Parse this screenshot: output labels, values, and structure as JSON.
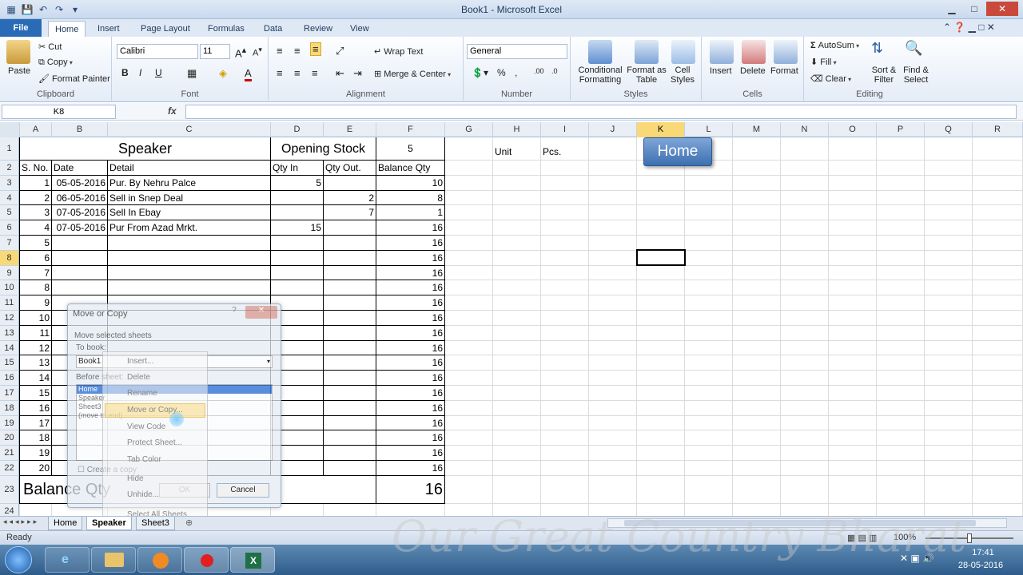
{
  "window": {
    "title": "Book1  -  Microsoft Excel"
  },
  "ribbon_tabs": [
    "File",
    "Home",
    "Insert",
    "Page Layout",
    "Formulas",
    "Data",
    "Review",
    "View"
  ],
  "clipboard": {
    "paste": "Paste",
    "cut": "Cut",
    "copy": "Copy",
    "format_painter": "Format Painter",
    "label": "Clipboard"
  },
  "font": {
    "name": "Calibri",
    "size": "11",
    "label": "Font"
  },
  "alignment": {
    "wrap": "Wrap Text",
    "merge": "Merge & Center",
    "label": "Alignment"
  },
  "number": {
    "format": "General",
    "label": "Number"
  },
  "styles": {
    "conditional": "Conditional Formatting",
    "format_table": "Format as Table",
    "cell_styles": "Cell Styles",
    "label": "Styles"
  },
  "cells": {
    "insert": "Insert",
    "delete": "Delete",
    "format": "Format",
    "label": "Cells"
  },
  "editing": {
    "autosum": "AutoSum",
    "fill": "Fill",
    "clear": "Clear",
    "sort": "Sort & Filter",
    "find": "Find & Select",
    "label": "Editing"
  },
  "formula_bar": {
    "name_box": "K8",
    "fx": "fx"
  },
  "columns": [
    "A",
    "B",
    "C",
    "D",
    "E",
    "F",
    "G",
    "H",
    "I",
    "J",
    "K",
    "L",
    "M",
    "N",
    "O",
    "P",
    "Q",
    "R"
  ],
  "rows": [
    "1",
    "2",
    "3",
    "4",
    "5",
    "6",
    "7",
    "8",
    "9",
    "10",
    "11",
    "12",
    "13",
    "14",
    "15",
    "16",
    "17",
    "18",
    "19",
    "20",
    "21",
    "22",
    "23",
    "24"
  ],
  "sheet": {
    "title": "Speaker",
    "opening_stock_label": "Opening Stock",
    "opening_stock": "5",
    "unit_label": "Unit",
    "unit_value": "Pcs.",
    "home_button": "Home",
    "headers": [
      "S. No.",
      "Date",
      "Detail",
      "Qty In",
      "Qty Out.",
      "Balance Qty"
    ],
    "data_rows": [
      [
        "1",
        "05-05-2016",
        "Pur. By Nehru Palce",
        "5",
        "",
        "10"
      ],
      [
        "2",
        "06-05-2016",
        "Sell in Snep Deal",
        "",
        "2",
        "8"
      ],
      [
        "3",
        "07-05-2016",
        "Sell In Ebay",
        "",
        "7",
        "1"
      ],
      [
        "4",
        "07-05-2016",
        "Pur From Azad Mrkt.",
        "15",
        "",
        "16"
      ],
      [
        "5",
        "",
        "",
        "",
        "",
        "16"
      ],
      [
        "6",
        "",
        "",
        "",
        "",
        "16"
      ],
      [
        "7",
        "",
        "",
        "",
        "",
        "16"
      ],
      [
        "8",
        "",
        "",
        "",
        "",
        "16"
      ],
      [
        "9",
        "",
        "",
        "",
        "",
        "16"
      ],
      [
        "10",
        "",
        "",
        "",
        "",
        "16"
      ],
      [
        "11",
        "",
        "",
        "",
        "",
        "16"
      ],
      [
        "12",
        "",
        "",
        "",
        "",
        "16"
      ],
      [
        "13",
        "",
        "",
        "",
        "",
        "16"
      ],
      [
        "14",
        "",
        "",
        "",
        "",
        "16"
      ],
      [
        "15",
        "",
        "",
        "",
        "",
        "16"
      ],
      [
        "16",
        "",
        "",
        "",
        "",
        "16"
      ],
      [
        "17",
        "",
        "",
        "",
        "",
        "16"
      ],
      [
        "18",
        "",
        "",
        "",
        "",
        "16"
      ],
      [
        "19",
        "",
        "",
        "",
        "",
        "16"
      ],
      [
        "20",
        "",
        "",
        "",
        "",
        "16"
      ]
    ],
    "balance_label": "Balance Qty",
    "balance_value": "16"
  },
  "dialog": {
    "title": "Move or Copy",
    "move_label": "Move selected sheets",
    "to_book": "To book:",
    "book": "Book1",
    "before_sheet": "Before sheet:",
    "sheets": [
      "Home",
      "Speaker",
      "Sheet3",
      "(move to end)"
    ],
    "create_copy": "Create a copy",
    "ok": "OK",
    "cancel": "Cancel"
  },
  "context_menu": [
    "Insert...",
    "Delete",
    "Rename",
    "Move or Copy...",
    "View Code",
    "Protect Sheet...",
    "Tab Color",
    "Hide",
    "Unhide...",
    "Select All Sheets"
  ],
  "sheet_tabs": [
    "Home",
    "Speaker",
    "Sheet3"
  ],
  "status": {
    "ready": "Ready",
    "zoom": "100%"
  },
  "taskbar": {
    "time": "17:41",
    "date": "28-05-2016"
  },
  "watermark": "Our Great Country Bharat"
}
